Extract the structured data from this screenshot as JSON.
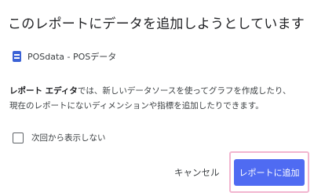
{
  "dialog": {
    "title": "このレポートにデータを追加しようとしています",
    "source": {
      "icon": "document-icon",
      "name": "POSdata - POSデータ"
    },
    "description": {
      "bold": "レポート エディタ",
      "line1_rest": "では、新しいデータソースを使ってグラフを作成したり、",
      "line2": "現在のレポートにないディメンションや指標を追加したりできます。"
    },
    "checkbox": {
      "label": "次回から表示しない",
      "checked": false
    },
    "buttons": {
      "cancel_label": "キャンセル",
      "add_label": "レポートに追加"
    },
    "colors": {
      "primary": "#4f6bf2",
      "highlight": "#f2b5cf",
      "source_icon": "#3b62d6"
    }
  }
}
